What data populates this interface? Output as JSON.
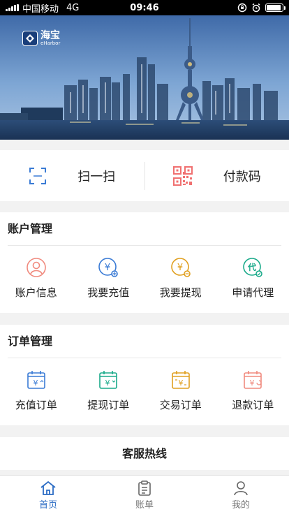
{
  "status_bar": {
    "carrier": "中国移动",
    "network": "4G",
    "time": "09:46",
    "battery_level": 0.9
  },
  "banner": {
    "logo_text": "海宝",
    "logo_subtext": "eHarbor"
  },
  "quick_actions": [
    {
      "label": "扫一扫",
      "icon": "scan-icon"
    },
    {
      "label": "付款码",
      "icon": "qr-code-icon"
    }
  ],
  "account_section": {
    "title": "账户管理",
    "items": [
      {
        "label": "账户信息",
        "icon": "user-circle-icon",
        "color": "#f08a7e"
      },
      {
        "label": "我要充值",
        "icon": "yuan-recharge-icon",
        "color": "#3a7bd5"
      },
      {
        "label": "我要提现",
        "icon": "yuan-withdraw-icon",
        "color": "#e0a020"
      },
      {
        "label": "申请代理",
        "icon": "agent-icon",
        "color": "#1aaa8a"
      }
    ]
  },
  "order_section": {
    "title": "订单管理",
    "items": [
      {
        "label": "充值订单",
        "icon": "recharge-order-icon",
        "color": "#3a7bd5"
      },
      {
        "label": "提现订单",
        "icon": "withdraw-order-icon",
        "color": "#1aaa8a"
      },
      {
        "label": "交易订单",
        "icon": "trade-order-icon",
        "color": "#e0a020"
      },
      {
        "label": "退款订单",
        "icon": "refund-order-icon",
        "color": "#f08a7e"
      }
    ]
  },
  "hotline": {
    "label": "客服热线"
  },
  "tabbar": {
    "items": [
      {
        "label": "首页",
        "icon": "home-icon",
        "active": true
      },
      {
        "label": "账单",
        "icon": "bill-icon",
        "active": false
      },
      {
        "label": "我的",
        "icon": "profile-icon",
        "active": false
      }
    ],
    "active_color": "#2b6cc4"
  }
}
